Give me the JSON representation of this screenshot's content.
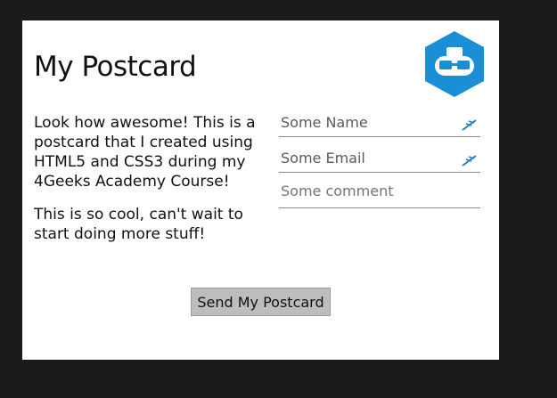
{
  "postcard": {
    "title": "My Postcard",
    "logo_icon": "hexagon-robot-logo-icon",
    "brand_color": "#1a8fd6",
    "paragraphs": [
      "Look how awesome! This is a postcard that I created using HTML5 and CSS3 during my 4Geeks Academy Course!",
      "This is so cool, can't wait to start doing more stuff!"
    ]
  },
  "form": {
    "name_placeholder": "Some Name",
    "email_placeholder": "Some Email",
    "comment_placeholder": "Some comment",
    "field_icon": "pen-icon",
    "send_label": "Send My Postcard"
  }
}
